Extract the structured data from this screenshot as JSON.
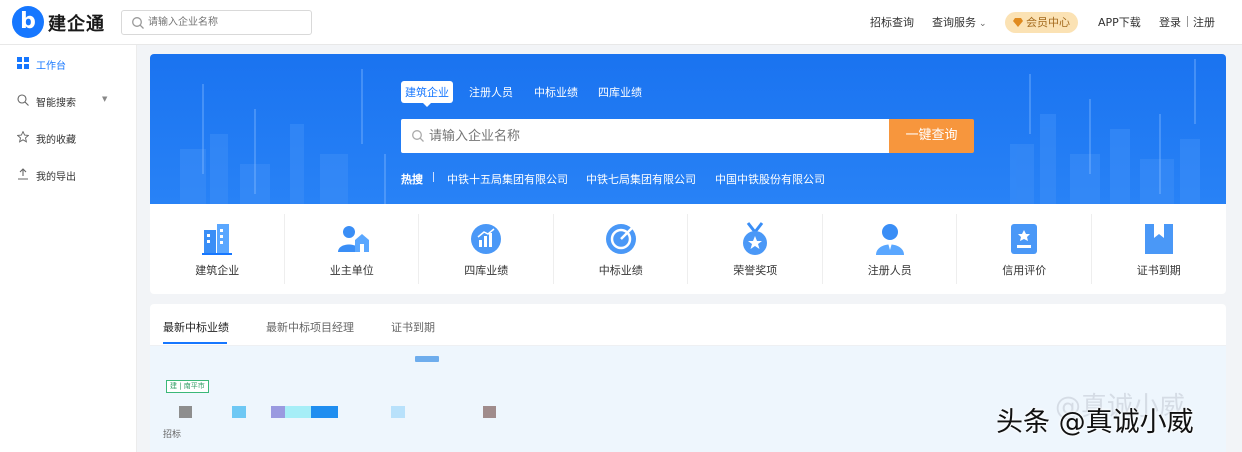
{
  "brand": {
    "logo_letter": "b",
    "name": "建企通"
  },
  "header": {
    "search_placeholder": "请输入企业名称",
    "nav_tender_query": "招标查询",
    "nav_query_service": "查询服务",
    "vip_center": "会员中心",
    "app_download": "APP下载",
    "login": "登录",
    "register": "注册"
  },
  "sidebar": {
    "items": [
      {
        "label": "工作台",
        "icon": "grid-icon",
        "active": true
      },
      {
        "label": "智能搜索",
        "icon": "search-icon",
        "active": false
      },
      {
        "label": "我的收藏",
        "icon": "star-icon",
        "active": false
      },
      {
        "label": "我的导出",
        "icon": "export-icon",
        "active": false
      }
    ]
  },
  "banner": {
    "tabs": [
      "建筑企业",
      "注册人员",
      "中标业绩",
      "四库业绩"
    ],
    "search_placeholder": "请输入企业名称",
    "search_button": "一键查询",
    "hot_label": "热搜",
    "hot_links": [
      "中铁十五局集团有限公司",
      "中铁七局集团有限公司",
      "中国中铁股份有限公司"
    ]
  },
  "categories": [
    {
      "label": "建筑企业",
      "icon": "building-icon"
    },
    {
      "label": "业主单位",
      "icon": "owner-icon"
    },
    {
      "label": "四库业绩",
      "icon": "chart-icon"
    },
    {
      "label": "中标业绩",
      "icon": "target-icon"
    },
    {
      "label": "荣誉奖项",
      "icon": "medal-icon"
    },
    {
      "label": "注册人员",
      "icon": "person-icon"
    },
    {
      "label": "信用评价",
      "icon": "credit-icon"
    },
    {
      "label": "证书到期",
      "icon": "bookmark-icon"
    }
  ],
  "panel": {
    "tabs": [
      "最新中标业绩",
      "最新中标项目经理",
      "证书到期"
    ],
    "card_tag": "建 | 南平市",
    "card_type": "招标"
  },
  "watermark": {
    "text": "头条 @真诚小威",
    "ghost": "@真诚小威"
  },
  "colors": {
    "primary": "#1677ff",
    "accent_orange": "#f7963d",
    "vip_bg": "#fbe2b4"
  }
}
